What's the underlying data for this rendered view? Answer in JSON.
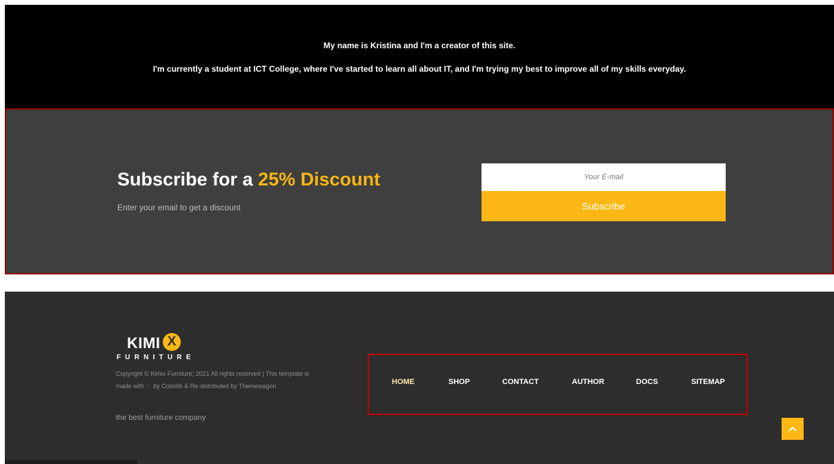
{
  "about": {
    "line1": "My name is Kristina and I'm a creator of this site.",
    "line2": "I'm currently a student at ICT College, where I've started to learn all about IT, and I'm trying my best to improve all of my skills everyday."
  },
  "subscribe": {
    "title_prefix": "Subscribe for a ",
    "title_accent": "25% Discount",
    "description": "Enter your email to get a discount",
    "email_placeholder": "Your E-mail",
    "email_value": "",
    "button_label": "Subscribe",
    "accent_color": "#fbb713"
  },
  "footer": {
    "logo": {
      "wordmark": "KIMI",
      "mark": "X",
      "subtitle": "FURNITURE"
    },
    "copyright": "Copyright © Kimix Furniture; 2021 All rights reserved | This template is made with ♡ by Colorlib & Re-distributed by Themewagon",
    "tagline": "the best furniture company",
    "nav": [
      {
        "label": "HOME"
      },
      {
        "label": "SHOP"
      },
      {
        "label": "CONTACT"
      },
      {
        "label": "AUTHOR"
      },
      {
        "label": "DOCS"
      },
      {
        "label": "SITEMAP"
      }
    ],
    "back_to_top_icon": "chevron-up-icon"
  }
}
